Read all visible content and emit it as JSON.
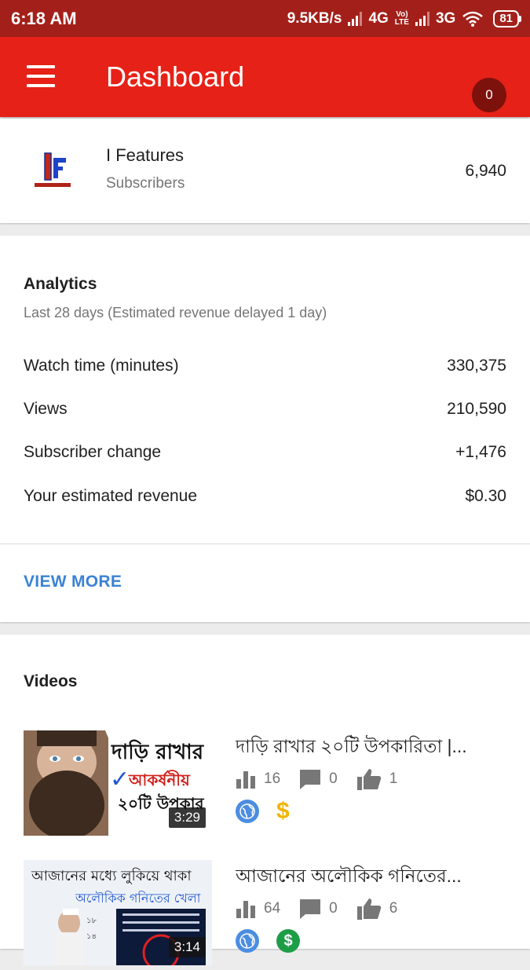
{
  "status": {
    "time": "6:18 AM",
    "speed": "9.5KB/s",
    "net1": "4G",
    "volte_top": "Vo)",
    "volte_bottom": "LTE",
    "net2": "3G",
    "battery": "81"
  },
  "appbar": {
    "title": "Dashboard",
    "notification_count": "0"
  },
  "channel": {
    "name": "I Features",
    "subscribers_label": "Subscribers",
    "subscribers_count": "6,940"
  },
  "analytics": {
    "title": "Analytics",
    "subtitle": "Last 28 days (Estimated revenue delayed 1 day)",
    "metrics": [
      {
        "label": "Watch time (minutes)",
        "value": "330,375"
      },
      {
        "label": "Views",
        "value": "210,590"
      },
      {
        "label": "Subscriber change",
        "value": "+1,476"
      },
      {
        "label": "Your estimated revenue",
        "value": "$0.30"
      }
    ],
    "view_more": "VIEW MORE"
  },
  "videos": {
    "title": "Videos",
    "items": [
      {
        "title": "দাড়ি রাখার ২০টি উপকারিতা |...",
        "duration": "3:29",
        "views": "16",
        "comments": "0",
        "likes": "1",
        "thumb_line1": "দাড়ি রাখার",
        "thumb_line2": "আকর্ষনীয়",
        "thumb_line3": "২০টি উপকার",
        "monetization": "$"
      },
      {
        "title": "আজানের অলৌকিক গনিতের...",
        "duration": "3:14",
        "views": "64",
        "comments": "0",
        "likes": "6",
        "thumb_line1": "আজানের মধ্যে লুকিয়ে থাকা",
        "thumb_line2": "অলৌকিক গনিতের খেলা",
        "monetization": "$"
      }
    ]
  },
  "colors": {
    "status_bar": "#a3201a",
    "app_bar": "#e62117",
    "link": "#3b82d6"
  }
}
